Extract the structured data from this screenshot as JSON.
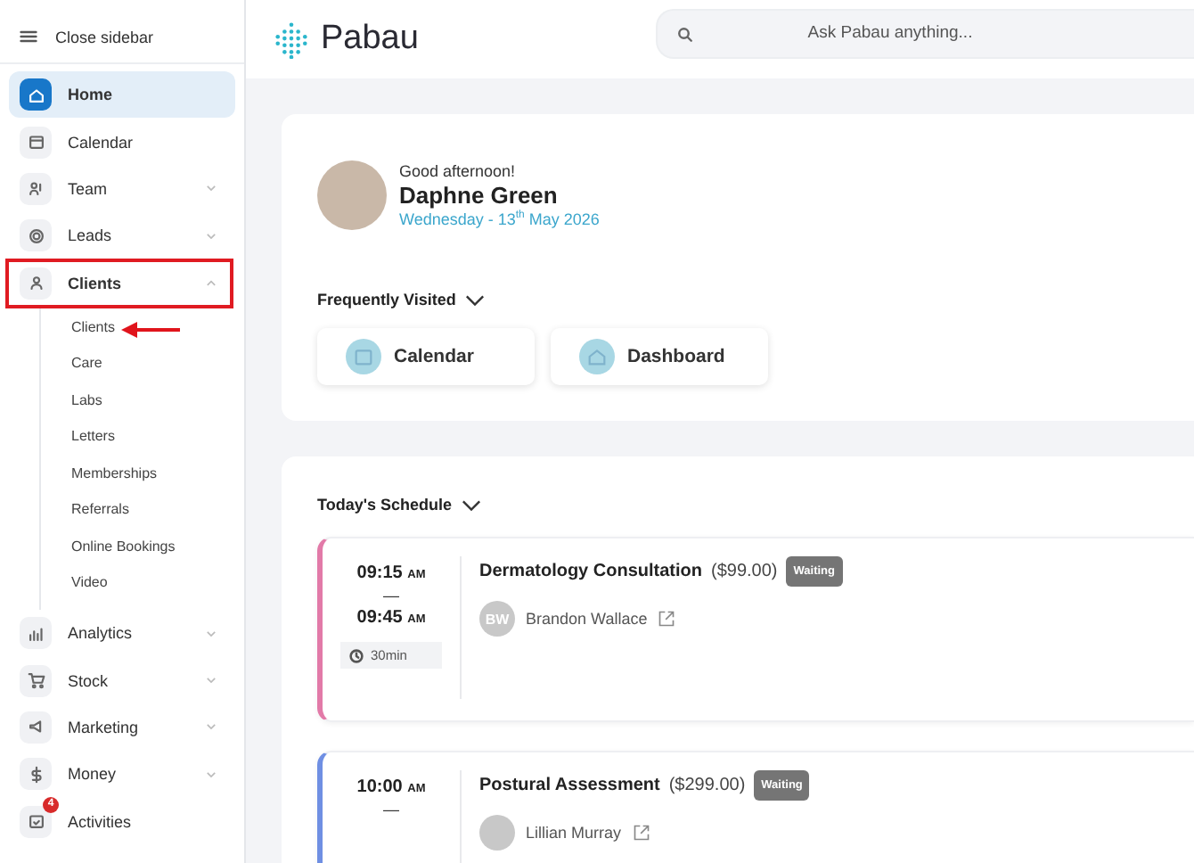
{
  "sidebar": {
    "toggle_label": "Close sidebar",
    "items": [
      {
        "label": "Home",
        "kind": "link",
        "selected": true,
        "highlighted": false
      },
      {
        "label": "Calendar",
        "kind": "link",
        "selected": false,
        "highlighted": false
      },
      {
        "label": "Team",
        "kind": "group",
        "selected": false,
        "expanded": false,
        "highlighted": false
      },
      {
        "label": "Leads",
        "kind": "group",
        "selected": false,
        "expanded": false,
        "highlighted": false
      },
      {
        "label": "Clients",
        "kind": "group",
        "selected": false,
        "expanded": true,
        "highlighted": true,
        "children": [
          {
            "label": "Clients",
            "pointed": true
          },
          {
            "label": "Care",
            "pointed": false
          },
          {
            "label": "Labs",
            "pointed": false
          },
          {
            "label": "Letters",
            "pointed": false
          },
          {
            "label": "Memberships",
            "pointed": false
          },
          {
            "label": "Referrals",
            "pointed": false
          },
          {
            "label": "Online Bookings",
            "pointed": false
          },
          {
            "label": "Video",
            "pointed": false
          }
        ]
      },
      {
        "label": "Analytics",
        "kind": "group",
        "selected": false,
        "expanded": false,
        "highlighted": false
      },
      {
        "label": "Stock",
        "kind": "group",
        "selected": false,
        "expanded": false,
        "highlighted": false
      },
      {
        "label": "Marketing",
        "kind": "group",
        "selected": false,
        "expanded": false,
        "highlighted": false
      },
      {
        "label": "Money",
        "kind": "group",
        "selected": false,
        "expanded": false,
        "highlighted": false
      },
      {
        "label": "Activities",
        "kind": "link",
        "selected": false,
        "highlighted": false,
        "badge": "4"
      }
    ]
  },
  "header": {
    "brand": "Pabau",
    "search": {
      "placeholder": "Ask Pabau anything..."
    }
  },
  "welcome": {
    "greeting": "Good afternoon!",
    "name": "Daphne Green",
    "date": "Wednesday - 13$^{th}$ May 2026",
    "frequently_visited": {
      "title": "Frequently Visited",
      "items": [
        {
          "label": "Calendar"
        },
        {
          "label": "Dashboard"
        }
      ]
    }
  },
  "schedule": {
    "title": "Today's Schedule",
    "appointments": [
      {
        "color": "#e27aa8",
        "start": "09:15",
        "start_period": "AM",
        "separator": "—",
        "end": "09:45",
        "end_period": "AM",
        "duration": "30min",
        "service": "Dermatology Consultation",
        "price": "($99.00)",
        "status": "Waiting",
        "client_initials": "BW",
        "client": "Brandon Wallace"
      },
      {
        "color": "#6f8fe3",
        "start": "10:00",
        "start_period": "AM",
        "separator": "—",
        "service": "Postural Assessment",
        "price": "($299.00)",
        "status": "Waiting",
        "client": "Lillian Murray"
      }
    ]
  }
}
